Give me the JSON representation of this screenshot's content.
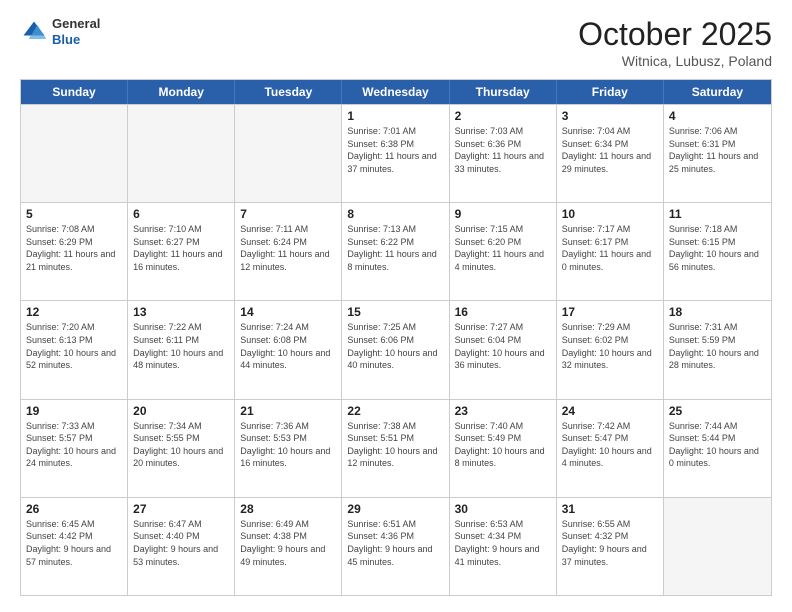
{
  "header": {
    "logo": {
      "general": "General",
      "blue": "Blue"
    },
    "title": "October 2025",
    "subtitle": "Witnica, Lubusz, Poland"
  },
  "weekdays": [
    "Sunday",
    "Monday",
    "Tuesday",
    "Wednesday",
    "Thursday",
    "Friday",
    "Saturday"
  ],
  "rows": [
    [
      {
        "num": "",
        "info": ""
      },
      {
        "num": "",
        "info": ""
      },
      {
        "num": "",
        "info": ""
      },
      {
        "num": "1",
        "info": "Sunrise: 7:01 AM\nSunset: 6:38 PM\nDaylight: 11 hours\nand 37 minutes."
      },
      {
        "num": "2",
        "info": "Sunrise: 7:03 AM\nSunset: 6:36 PM\nDaylight: 11 hours\nand 33 minutes."
      },
      {
        "num": "3",
        "info": "Sunrise: 7:04 AM\nSunset: 6:34 PM\nDaylight: 11 hours\nand 29 minutes."
      },
      {
        "num": "4",
        "info": "Sunrise: 7:06 AM\nSunset: 6:31 PM\nDaylight: 11 hours\nand 25 minutes."
      }
    ],
    [
      {
        "num": "5",
        "info": "Sunrise: 7:08 AM\nSunset: 6:29 PM\nDaylight: 11 hours\nand 21 minutes."
      },
      {
        "num": "6",
        "info": "Sunrise: 7:10 AM\nSunset: 6:27 PM\nDaylight: 11 hours\nand 16 minutes."
      },
      {
        "num": "7",
        "info": "Sunrise: 7:11 AM\nSunset: 6:24 PM\nDaylight: 11 hours\nand 12 minutes."
      },
      {
        "num": "8",
        "info": "Sunrise: 7:13 AM\nSunset: 6:22 PM\nDaylight: 11 hours\nand 8 minutes."
      },
      {
        "num": "9",
        "info": "Sunrise: 7:15 AM\nSunset: 6:20 PM\nDaylight: 11 hours\nand 4 minutes."
      },
      {
        "num": "10",
        "info": "Sunrise: 7:17 AM\nSunset: 6:17 PM\nDaylight: 11 hours\nand 0 minutes."
      },
      {
        "num": "11",
        "info": "Sunrise: 7:18 AM\nSunset: 6:15 PM\nDaylight: 10 hours\nand 56 minutes."
      }
    ],
    [
      {
        "num": "12",
        "info": "Sunrise: 7:20 AM\nSunset: 6:13 PM\nDaylight: 10 hours\nand 52 minutes."
      },
      {
        "num": "13",
        "info": "Sunrise: 7:22 AM\nSunset: 6:11 PM\nDaylight: 10 hours\nand 48 minutes."
      },
      {
        "num": "14",
        "info": "Sunrise: 7:24 AM\nSunset: 6:08 PM\nDaylight: 10 hours\nand 44 minutes."
      },
      {
        "num": "15",
        "info": "Sunrise: 7:25 AM\nSunset: 6:06 PM\nDaylight: 10 hours\nand 40 minutes."
      },
      {
        "num": "16",
        "info": "Sunrise: 7:27 AM\nSunset: 6:04 PM\nDaylight: 10 hours\nand 36 minutes."
      },
      {
        "num": "17",
        "info": "Sunrise: 7:29 AM\nSunset: 6:02 PM\nDaylight: 10 hours\nand 32 minutes."
      },
      {
        "num": "18",
        "info": "Sunrise: 7:31 AM\nSunset: 5:59 PM\nDaylight: 10 hours\nand 28 minutes."
      }
    ],
    [
      {
        "num": "19",
        "info": "Sunrise: 7:33 AM\nSunset: 5:57 PM\nDaylight: 10 hours\nand 24 minutes."
      },
      {
        "num": "20",
        "info": "Sunrise: 7:34 AM\nSunset: 5:55 PM\nDaylight: 10 hours\nand 20 minutes."
      },
      {
        "num": "21",
        "info": "Sunrise: 7:36 AM\nSunset: 5:53 PM\nDaylight: 10 hours\nand 16 minutes."
      },
      {
        "num": "22",
        "info": "Sunrise: 7:38 AM\nSunset: 5:51 PM\nDaylight: 10 hours\nand 12 minutes."
      },
      {
        "num": "23",
        "info": "Sunrise: 7:40 AM\nSunset: 5:49 PM\nDaylight: 10 hours\nand 8 minutes."
      },
      {
        "num": "24",
        "info": "Sunrise: 7:42 AM\nSunset: 5:47 PM\nDaylight: 10 hours\nand 4 minutes."
      },
      {
        "num": "25",
        "info": "Sunrise: 7:44 AM\nSunset: 5:44 PM\nDaylight: 10 hours\nand 0 minutes."
      }
    ],
    [
      {
        "num": "26",
        "info": "Sunrise: 6:45 AM\nSunset: 4:42 PM\nDaylight: 9 hours\nand 57 minutes."
      },
      {
        "num": "27",
        "info": "Sunrise: 6:47 AM\nSunset: 4:40 PM\nDaylight: 9 hours\nand 53 minutes."
      },
      {
        "num": "28",
        "info": "Sunrise: 6:49 AM\nSunset: 4:38 PM\nDaylight: 9 hours\nand 49 minutes."
      },
      {
        "num": "29",
        "info": "Sunrise: 6:51 AM\nSunset: 4:36 PM\nDaylight: 9 hours\nand 45 minutes."
      },
      {
        "num": "30",
        "info": "Sunrise: 6:53 AM\nSunset: 4:34 PM\nDaylight: 9 hours\nand 41 minutes."
      },
      {
        "num": "31",
        "info": "Sunrise: 6:55 AM\nSunset: 4:32 PM\nDaylight: 9 hours\nand 37 minutes."
      },
      {
        "num": "",
        "info": ""
      }
    ]
  ]
}
